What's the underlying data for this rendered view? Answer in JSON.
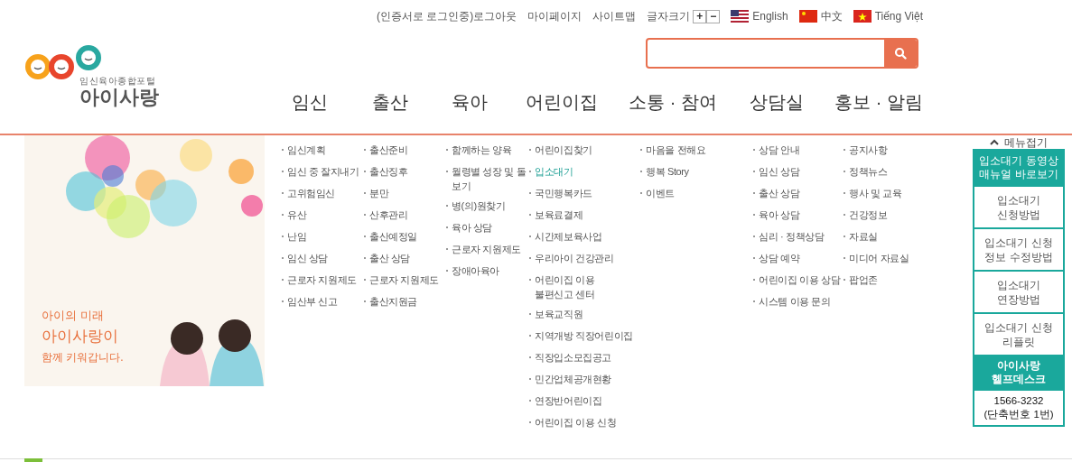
{
  "top_links": [
    "(인증서로 로그인중)로그아웃",
    "마이페이지",
    "사이트맵"
  ],
  "font_size": {
    "label": "글자크기",
    "buttons": [
      "+",
      "−"
    ]
  },
  "languages": [
    {
      "label": "English",
      "kind": "us"
    },
    {
      "label": "中文",
      "kind": "cn"
    },
    {
      "label": "Tiếng Việt",
      "kind": "vn"
    }
  ],
  "logo": {
    "subtitle": "임신육아종합포털",
    "name": "아이사랑"
  },
  "menu": [
    {
      "label": "임신",
      "submenu": [
        {
          "label": "임신계획",
          "highlighted": false
        },
        {
          "label": "임신 중 잘지내기",
          "highlighted": false
        },
        {
          "label": "고위험임신",
          "highlighted": false
        },
        {
          "label": "유산",
          "highlighted": false
        },
        {
          "label": "난임",
          "highlighted": false
        },
        {
          "label": "임신 상담",
          "highlighted": false
        },
        {
          "label": "근로자 지원제도",
          "highlighted": false
        },
        {
          "label": "임산부 신고",
          "highlighted": false
        }
      ]
    },
    {
      "label": "출산",
      "submenu": [
        {
          "label": "출산준비",
          "highlighted": false
        },
        {
          "label": "출산징후",
          "highlighted": false
        },
        {
          "label": "분만",
          "highlighted": false
        },
        {
          "label": "산후관리",
          "highlighted": false
        },
        {
          "label": "출산예정일",
          "highlighted": false
        },
        {
          "label": "출산 상담",
          "highlighted": false
        },
        {
          "label": "근로자 지원제도",
          "highlighted": false
        },
        {
          "label": "출산지원금",
          "highlighted": false
        }
      ]
    },
    {
      "label": "육아",
      "submenu": [
        {
          "label": "함께하는 양육",
          "highlighted": false
        },
        {
          "label": "월령별 성장 및 돌\n보기",
          "highlighted": false
        },
        {
          "label": "병(의)원찾기",
          "highlighted": false
        },
        {
          "label": "육아 상담",
          "highlighted": false
        },
        {
          "label": "근로자 지원제도",
          "highlighted": false
        },
        {
          "label": "장애아육아",
          "highlighted": false
        }
      ]
    },
    {
      "label": "어린이집",
      "submenu": [
        {
          "label": "어린이집찾기",
          "highlighted": false
        },
        {
          "label": "입소대기",
          "highlighted": true
        },
        {
          "label": "국민행복카드",
          "highlighted": false
        },
        {
          "label": "보육료결제",
          "highlighted": false
        },
        {
          "label": "시간제보육사업",
          "highlighted": false
        },
        {
          "label": "우리아이 건강관리",
          "highlighted": false
        },
        {
          "label": "어린이집 이용\n불편신고 센터",
          "highlighted": false
        },
        {
          "label": "보육교직원",
          "highlighted": false
        },
        {
          "label": "지역개방 직장어린이집",
          "highlighted": false
        },
        {
          "label": "직장입소모집공고",
          "highlighted": false
        },
        {
          "label": "민간업체공개현황",
          "highlighted": false
        },
        {
          "label": "연장반어린이집",
          "highlighted": false
        },
        {
          "label": "어린이집 이용 신청",
          "highlighted": false
        }
      ]
    },
    {
      "label": "소통 · 참여",
      "submenu": [
        {
          "label": "마음을 전해요",
          "highlighted": false
        },
        {
          "label": "행복 Story",
          "highlighted": false
        },
        {
          "label": "이벤트",
          "highlighted": false
        }
      ]
    },
    {
      "label": "상담실",
      "submenu": [
        {
          "label": "상담 안내",
          "highlighted": false
        },
        {
          "label": "임신 상담",
          "highlighted": false
        },
        {
          "label": "출산 상담",
          "highlighted": false
        },
        {
          "label": "육아 상담",
          "highlighted": false
        },
        {
          "label": "심리 · 정책상담",
          "highlighted": false
        },
        {
          "label": "상담 예약",
          "highlighted": false
        },
        {
          "label": "어린이집 이용 상담",
          "highlighted": false
        },
        {
          "label": "시스템 이용 문의",
          "highlighted": false
        }
      ]
    },
    {
      "label": "홍보 · 알림",
      "submenu": [
        {
          "label": "공지사항",
          "highlighted": false
        },
        {
          "label": "정책뉴스",
          "highlighted": false
        },
        {
          "label": "행사 및 교육",
          "highlighted": false
        },
        {
          "label": "건강정보",
          "highlighted": false
        },
        {
          "label": "자료실",
          "highlighted": false
        },
        {
          "label": "미디어 자료실",
          "highlighted": false
        },
        {
          "label": "팝업존",
          "highlighted": false
        }
      ]
    }
  ],
  "banner": {
    "lines": [
      "아이의 미래",
      "아이사랑이",
      "함께 키워갑니다."
    ]
  },
  "quick_panel": {
    "toggle": "메뉴접기",
    "items": [
      {
        "label": "입소대기 동영상\n매뉴얼 바로보기",
        "kind": "header"
      },
      {
        "label": "입소대기\n신청방법",
        "kind": "link"
      },
      {
        "label": "입소대기 신청\n정보 수정방법",
        "kind": "link"
      },
      {
        "label": "입소대기\n연장방법",
        "kind": "link"
      },
      {
        "label": "입소대기 신청\n리플릿",
        "kind": "link"
      },
      {
        "label": "아이사랑\n헬프데스크",
        "kind": "helpdesk"
      },
      {
        "label": "1566-3232\n(단축번호 1번)",
        "kind": "phone"
      }
    ]
  }
}
